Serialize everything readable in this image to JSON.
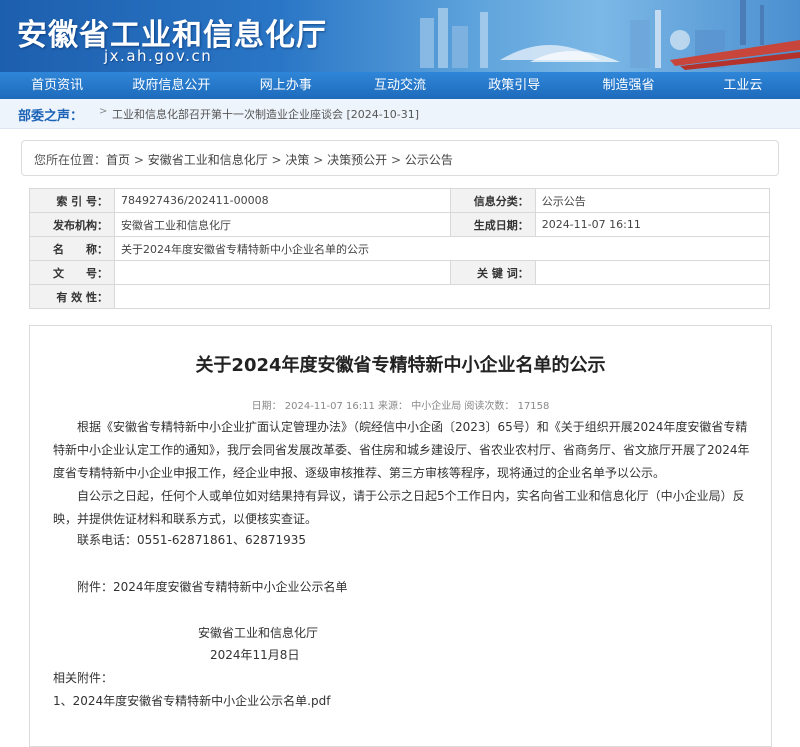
{
  "header": {
    "site_title": "安徽省工业和信息化厅",
    "domain": "jx.ah.gov.cn"
  },
  "nav": {
    "items": [
      "首页资讯",
      "政府信息公开",
      "网上办事",
      "互动交流",
      "政策引导",
      "制造强省",
      "工业云"
    ]
  },
  "notice": {
    "label": "部委之声：",
    "arrow": ">",
    "text": "工业和信息化部召开第十一次制造业企业座谈会 [2024-10-31]"
  },
  "breadcrumb": {
    "prefix": "您所在位置：",
    "items": [
      "首页",
      "安徽省工业和信息化厅",
      "决策",
      "决策预公开",
      "公示公告"
    ],
    "sep": " > "
  },
  "info": {
    "index_label": "索 引 号：",
    "index_value": "784927436/202411-00008",
    "category_label": "信息分类：",
    "category_value": "公示公告",
    "publisher_label": "发布机构：",
    "publisher_value": "安徽省工业和信息化厅",
    "date_label": "生成日期：",
    "date_value": "2024-11-07 16:11",
    "name_label": "名　　称：",
    "name_value": "关于2024年度安徽省专精特新中小企业名单的公示",
    "docno_label": "文　　号：",
    "docno_value": "",
    "keyword_label": "关 键 词：",
    "keyword_value": "",
    "validity_label": "有 效 性：",
    "validity_value": ""
  },
  "article": {
    "title": "关于2024年度安徽省专精特新中小企业名单的公示",
    "meta": "日期：  2024-11-07 16:11    来源：  中小企业局    阅读次数：  17158",
    "para1": "根据《安徽省专精特新中小企业扩面认定管理办法》（皖经信中小企函〔2023〕65号）和《关于组织开展2024年度安徽省专精特新中小企业认定工作的通知》，我厅会同省发展改革委、省住房和城乡建设厅、省农业农村厅、省商务厅、省文旅厅开展了2024年度省专精特新中小企业申报工作，经企业申报、逐级审核推荐、第三方审核等程序，现将通过的企业名单予以公示。",
    "para2": "自公示之日起，任何个人或单位如对结果持有异议，请于公示之日起5个工作日内，实名向省工业和信息化厅（中小企业局）反映，并提供佐证材料和联系方式，以便核实查证。",
    "contact": "联系电话：0551-62871861、62871935",
    "attachment_note": "附件：2024年度安徽省专精特新中小企业公示名单",
    "signature": "安徽省工业和信息化厅",
    "sign_date": "2024年11月8日",
    "related_label": "相关附件：",
    "related_file": "1、2024年度安徽省专精特新中小企业公示名单.pdf"
  },
  "colors": {
    "nav_bg": "#1e6bbd",
    "accent": "#1c63b7"
  }
}
